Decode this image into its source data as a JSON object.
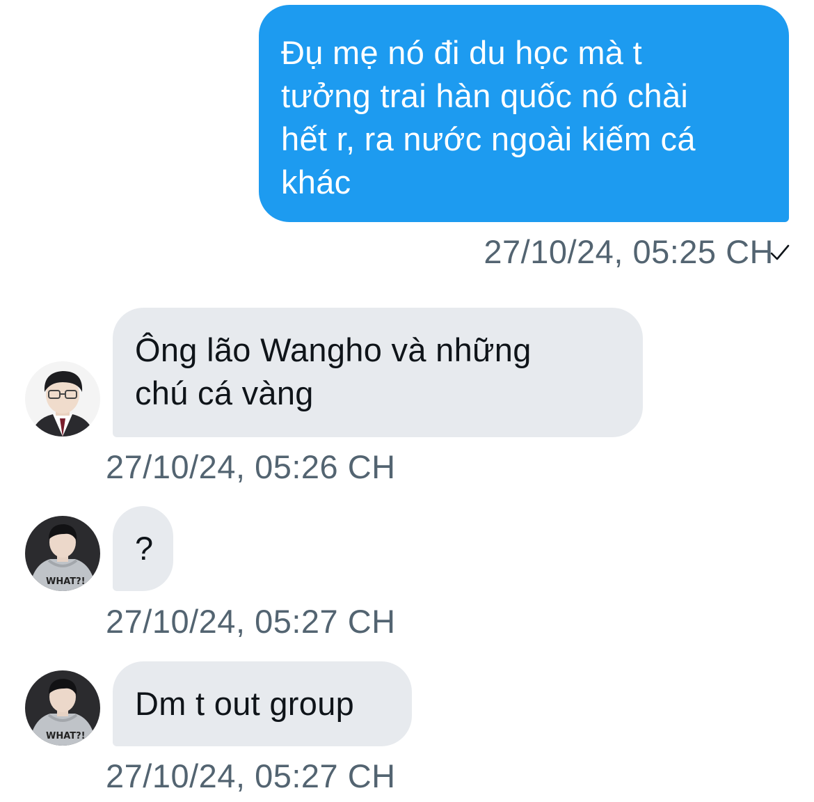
{
  "messages": [
    {
      "direction": "outgoing",
      "lines": [
        "Đụ mẹ nó đi du học mà t",
        "tưởng trai hàn quốc nó chài",
        "hết r, ra nước ngoài kiếm cá",
        "khác"
      ],
      "timestamp": "27/10/24, 05:25 CH",
      "status_icon": "checkmark-icon"
    },
    {
      "direction": "incoming",
      "lines": [
        "Ông lão Wangho và những",
        "chú cá vàng"
      ],
      "timestamp": "27/10/24, 05:26 CH",
      "avatar": "avatar-glasses"
    },
    {
      "direction": "incoming",
      "lines": [
        "?"
      ],
      "timestamp": "27/10/24, 05:27 CH",
      "avatar": "avatar-hoodie"
    },
    {
      "direction": "incoming",
      "lines": [
        "Dm t out group"
      ],
      "timestamp": "27/10/24, 05:27 CH",
      "avatar": "avatar-hoodie"
    }
  ],
  "colors": {
    "outgoing_bubble": "#1d9bf0",
    "incoming_bubble": "#e7eaee",
    "timestamp_text": "#536471"
  }
}
